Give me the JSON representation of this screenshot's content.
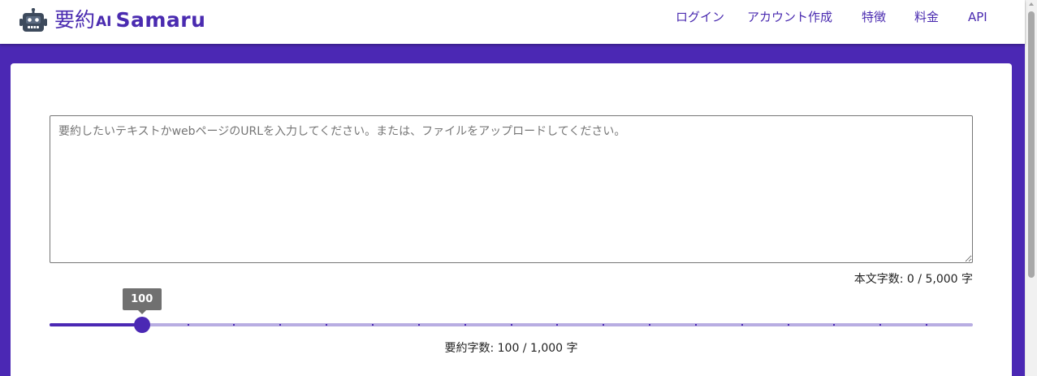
{
  "header": {
    "logo_jp": "要約",
    "logo_ai": "AI",
    "logo_name": "Samaru",
    "nav": {
      "login": "ログイン",
      "signup": "アカウント作成",
      "features": "特徴",
      "pricing": "料金",
      "api": "API"
    }
  },
  "colors": {
    "brand": "#4b28b4",
    "brand_text": "#4a2bb0",
    "track_light": "#b8ade2",
    "value_label_bg": "#707070"
  },
  "icons": {
    "logo": "robot-icon"
  },
  "input": {
    "placeholder": "要約したいテキストかwebページのURLを入力してください。または、ファイルをアップロードしてください。",
    "value": ""
  },
  "body_count": {
    "text": "本文字数: 0 / 5,000 字"
  },
  "summary_slider": {
    "min": 0,
    "max": 1000,
    "step": 50,
    "value": 100,
    "value_label": "100",
    "count_text": "要約字数: 100 / 1,000 字"
  }
}
